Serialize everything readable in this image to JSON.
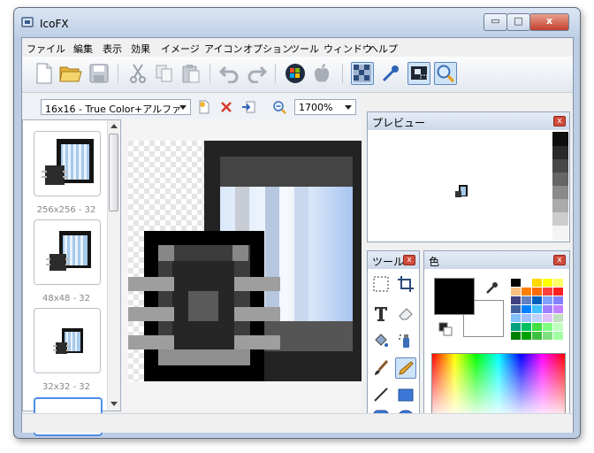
{
  "window": {
    "title": "IcoFX",
    "min_glyph": "▭",
    "max_glyph": "□",
    "close_glyph": "x"
  },
  "menu": [
    "ファイル",
    "編集",
    "表示",
    "効果",
    "イメージ",
    "アイコン",
    "オプション",
    "ツール",
    "ウィンドウ",
    "ヘルプ"
  ],
  "toolbar": [
    "new-file-icon",
    "open-folder-icon",
    "save-icon",
    "cut-icon",
    "copy-icon",
    "paste-icon",
    "undo-icon",
    "redo-icon",
    "windows-logo-icon",
    "apple-logo-icon",
    "checker-pattern-icon",
    "eyedropper-icon",
    "pointer-select-icon",
    "zoom-icon"
  ],
  "document": {
    "format": "16x16 - True Color+アルファ",
    "zoom": "1700%"
  },
  "thumbnails": [
    {
      "label": "256x256 - 32"
    },
    {
      "label": "48x48 - 32"
    },
    {
      "label": "32x32 - 32"
    },
    {
      "label": ""
    }
  ],
  "preview": {
    "title": "プレビュー",
    "close": "x"
  },
  "tools": {
    "title": "ツール",
    "close": "x",
    "items": [
      "marquee-select-icon",
      "crop-icon",
      "text-icon",
      "eraser-icon",
      "fill-bucket-icon",
      "spray-icon",
      "brush-icon",
      "pencil-icon",
      "line-icon",
      "rectangle-icon",
      "rounded-rectangle-icon",
      "ellipse-icon"
    ]
  },
  "colors": {
    "title": "色",
    "close": "x",
    "primary": "#000000",
    "secondary": "#ffffff",
    "palette": [
      "#000000",
      "#ffffff",
      "#ffd800",
      "#ffff00",
      "#ffff66",
      "#f9c080",
      "#ff8000",
      "#ff6a00",
      "#ff4040",
      "#ff2020",
      "#404080",
      "#6080c0",
      "#0060c0",
      "#80a0ff",
      "#8080ff",
      "#4060a0",
      "#0080ff",
      "#40c0ff",
      "#a080ff",
      "#c080ff",
      "#80c0ff",
      "#a0c0ff",
      "#c0d0ff",
      "#e0c0ff",
      "#c0e0c0",
      "#00a080",
      "#00c060",
      "#40e040",
      "#80ff80",
      "#c0ffc0",
      "#008000",
      "#00a000",
      "#40c040",
      "#80e080",
      "#a0ffa0"
    ]
  }
}
